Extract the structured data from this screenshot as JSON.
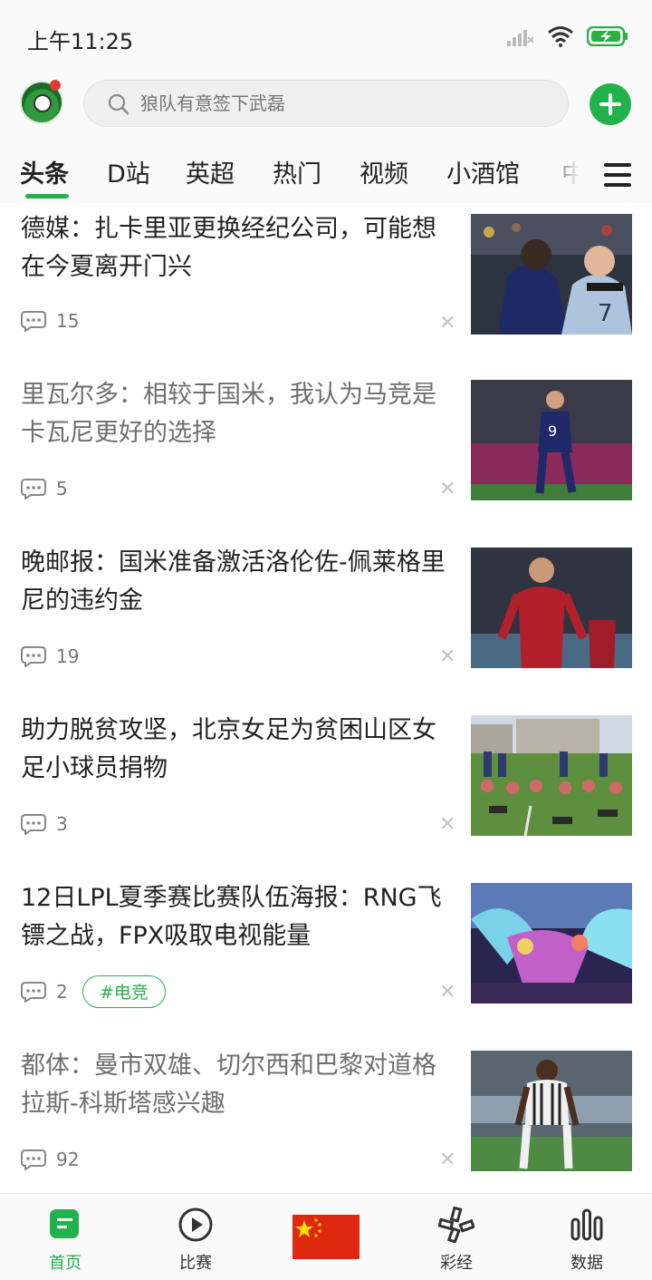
{
  "status_bar": {
    "time": "上午11:25"
  },
  "header": {
    "search_placeholder": "狼队有意签下武磊"
  },
  "tabs": [
    "头条",
    "D站",
    "英超",
    "热门",
    "视频",
    "小酒馆",
    "中"
  ],
  "feed": [
    {
      "title": "德媒：扎卡里亚更换经纪公司，可能想在今夏离开门兴",
      "comments": "15",
      "read": false
    },
    {
      "title": "里瓦尔多：相较于国米，我认为马竞是卡瓦尼更好的选择",
      "comments": "5",
      "read": true
    },
    {
      "title": "晚邮报：国米准备激活洛伦佐-佩莱格里尼的违约金",
      "comments": "19",
      "read": false
    },
    {
      "title": "助力脱贫攻坚，北京女足为贫困山区女足小球员捐物",
      "comments": "3",
      "read": false
    },
    {
      "title": "12日LPL夏季赛比赛队伍海报：RNG飞镖之战，FPX吸取电视能量",
      "comments": "2",
      "tag": "#电竞",
      "read": false
    },
    {
      "title": "都体：曼市双雄、切尔西和巴黎对道格拉斯-科斯塔感兴趣",
      "comments": "92",
      "read": true
    }
  ],
  "bottom_nav": [
    {
      "label": "首页",
      "active": true
    },
    {
      "label": "比赛"
    },
    {
      "label": ""
    },
    {
      "label": "彩经"
    },
    {
      "label": "数据"
    }
  ],
  "colors": {
    "accent": "#22b24c",
    "badge": "#e53935"
  }
}
